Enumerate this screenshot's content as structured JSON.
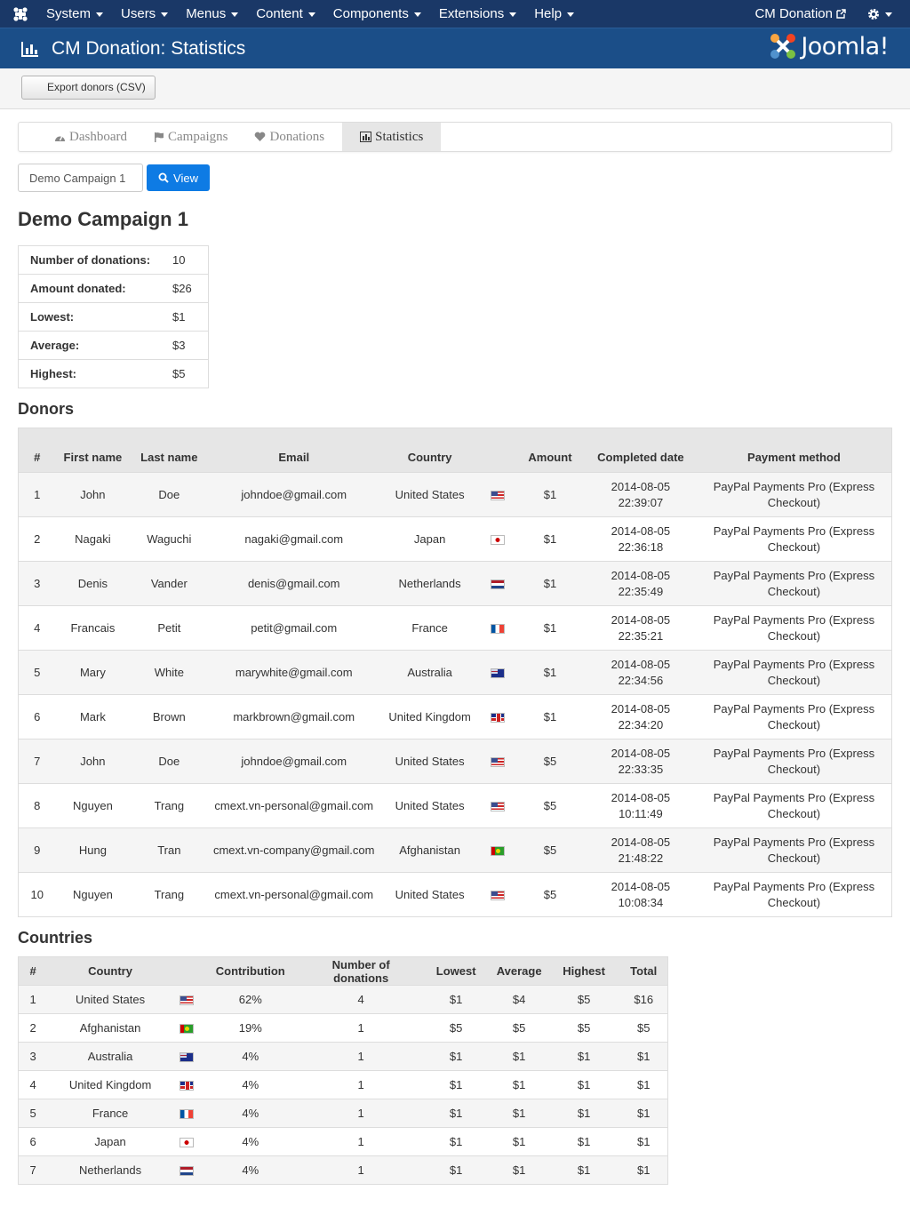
{
  "navbar": {
    "menus": [
      "System",
      "Users",
      "Menus",
      "Content",
      "Components",
      "Extensions",
      "Help"
    ],
    "right_link": "CM Donation"
  },
  "header": {
    "title": "CM Donation: Statistics",
    "brand": "Joomla!"
  },
  "toolbar": {
    "export_label": "Export donors (CSV)"
  },
  "tabs": [
    {
      "label": "Dashboard",
      "icon": "dashboard-icon"
    },
    {
      "label": "Campaigns",
      "icon": "flag-icon"
    },
    {
      "label": "Donations",
      "icon": "heart-icon"
    },
    {
      "label": "Statistics",
      "icon": "bar-chart-icon",
      "active": true
    }
  ],
  "search": {
    "campaign_value": "Demo Campaign 1",
    "view_label": "View"
  },
  "campaign_title": "Demo Campaign 1",
  "stats": [
    {
      "label": "Number of donations:",
      "value": "10"
    },
    {
      "label": "Amount donated:",
      "value": "$26"
    },
    {
      "label": "Lowest:",
      "value": "$1"
    },
    {
      "label": "Average:",
      "value": "$3"
    },
    {
      "label": "Highest:",
      "value": "$5"
    }
  ],
  "donors_title": "Donors",
  "donors_headers": [
    "#",
    "First name",
    "Last name",
    "Email",
    "Country",
    "Amount",
    "Completed date",
    "Payment method"
  ],
  "donors": [
    {
      "n": "1",
      "first": "John",
      "last": "Doe",
      "email": "johndoe@gmail.com",
      "country": "United States",
      "flag": "us",
      "amount": "$1",
      "date": "2014-08-05 22:39:07",
      "method": "PayPal Payments Pro (Express Checkout)"
    },
    {
      "n": "2",
      "first": "Nagaki",
      "last": "Waguchi",
      "email": "nagaki@gmail.com",
      "country": "Japan",
      "flag": "jp",
      "amount": "$1",
      "date": "2014-08-05 22:36:18",
      "method": "PayPal Payments Pro (Express Checkout)"
    },
    {
      "n": "3",
      "first": "Denis",
      "last": "Vander",
      "email": "denis@gmail.com",
      "country": "Netherlands",
      "flag": "nl",
      "amount": "$1",
      "date": "2014-08-05 22:35:49",
      "method": "PayPal Payments Pro (Express Checkout)"
    },
    {
      "n": "4",
      "first": "Francais",
      "last": "Petit",
      "email": "petit@gmail.com",
      "country": "France",
      "flag": "fr",
      "amount": "$1",
      "date": "2014-08-05 22:35:21",
      "method": "PayPal Payments Pro (Express Checkout)"
    },
    {
      "n": "5",
      "first": "Mary",
      "last": "White",
      "email": "marywhite@gmail.com",
      "country": "Australia",
      "flag": "au",
      "amount": "$1",
      "date": "2014-08-05 22:34:56",
      "method": "PayPal Payments Pro (Express Checkout)"
    },
    {
      "n": "6",
      "first": "Mark",
      "last": "Brown",
      "email": "markbrown@gmail.com",
      "country": "United Kingdom",
      "flag": "gb",
      "amount": "$1",
      "date": "2014-08-05 22:34:20",
      "method": "PayPal Payments Pro (Express Checkout)"
    },
    {
      "n": "7",
      "first": "John",
      "last": "Doe",
      "email": "johndoe@gmail.com",
      "country": "United States",
      "flag": "us",
      "amount": "$5",
      "date": "2014-08-05 22:33:35",
      "method": "PayPal Payments Pro (Express Checkout)"
    },
    {
      "n": "8",
      "first": "Nguyen",
      "last": "Trang",
      "email": "cmext.vn-personal@gmail.com",
      "country": "United States",
      "flag": "us",
      "amount": "$5",
      "date": "2014-08-05 10:11:49",
      "method": "PayPal Payments Pro (Express Checkout)"
    },
    {
      "n": "9",
      "first": "Hung",
      "last": "Tran",
      "email": "cmext.vn-company@gmail.com",
      "country": "Afghanistan",
      "flag": "af",
      "amount": "$5",
      "date": "2014-08-05 21:48:22",
      "method": "PayPal Payments Pro (Express Checkout)"
    },
    {
      "n": "10",
      "first": "Nguyen",
      "last": "Trang",
      "email": "cmext.vn-personal@gmail.com",
      "country": "United States",
      "flag": "us",
      "amount": "$5",
      "date": "2014-08-05 10:08:34",
      "method": "PayPal Payments Pro (Express Checkout)"
    }
  ],
  "countries_title": "Countries",
  "countries_headers": [
    "#",
    "Country",
    "Contribution",
    "Number of donations",
    "Lowest",
    "Average",
    "Highest",
    "Total"
  ],
  "countries": [
    {
      "n": "1",
      "country": "United States",
      "flag": "us",
      "contribution": "62%",
      "count": "4",
      "lowest": "$1",
      "average": "$4",
      "highest": "$5",
      "total": "$16"
    },
    {
      "n": "2",
      "country": "Afghanistan",
      "flag": "af",
      "contribution": "19%",
      "count": "1",
      "lowest": "$5",
      "average": "$5",
      "highest": "$5",
      "total": "$5"
    },
    {
      "n": "3",
      "country": "Australia",
      "flag": "au",
      "contribution": "4%",
      "count": "1",
      "lowest": "$1",
      "average": "$1",
      "highest": "$1",
      "total": "$1"
    },
    {
      "n": "4",
      "country": "United Kingdom",
      "flag": "gb",
      "contribution": "4%",
      "count": "1",
      "lowest": "$1",
      "average": "$1",
      "highest": "$1",
      "total": "$1"
    },
    {
      "n": "5",
      "country": "France",
      "flag": "fr",
      "contribution": "4%",
      "count": "1",
      "lowest": "$1",
      "average": "$1",
      "highest": "$1",
      "total": "$1"
    },
    {
      "n": "6",
      "country": "Japan",
      "flag": "jp",
      "contribution": "4%",
      "count": "1",
      "lowest": "$1",
      "average": "$1",
      "highest": "$1",
      "total": "$1"
    },
    {
      "n": "7",
      "country": "Netherlands",
      "flag": "nl",
      "contribution": "4%",
      "count": "1",
      "lowest": "$1",
      "average": "$1",
      "highest": "$1",
      "total": "$1"
    }
  ],
  "colors": {
    "navbar": "#1a3867",
    "header": "#1b4e88",
    "primary_button": "#0e7be4"
  }
}
